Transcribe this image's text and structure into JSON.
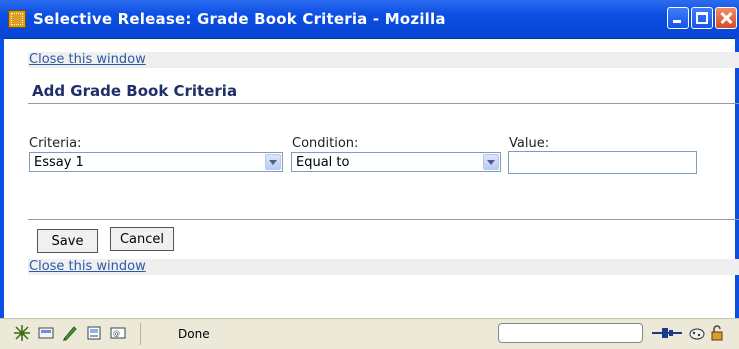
{
  "window": {
    "title": "Selective Release: Grade Book Criteria - Mozilla"
  },
  "links": {
    "close_top": "Close this window",
    "close_bottom": "Close this window"
  },
  "form": {
    "heading": "Add Grade Book Criteria",
    "criteria_label": "Criteria:",
    "criteria_value": "Essay 1",
    "condition_label": "Condition:",
    "condition_value": "Equal to",
    "value_label": "Value:",
    "value_input": ""
  },
  "buttons": {
    "save": "Save",
    "cancel": "Cancel"
  },
  "statusbar": {
    "status_text": "Done",
    "icons": [
      "navigator-icon",
      "mail-icon",
      "composer-icon",
      "address-book-icon",
      "irc-chat-icon"
    ],
    "right_icons": [
      "online-offline-icon",
      "cookie-icon",
      "lock-icon"
    ]
  },
  "colors": {
    "title_bar": "#0a4ee3",
    "link": "#2b5aa8",
    "heading": "#1f2f6a"
  }
}
